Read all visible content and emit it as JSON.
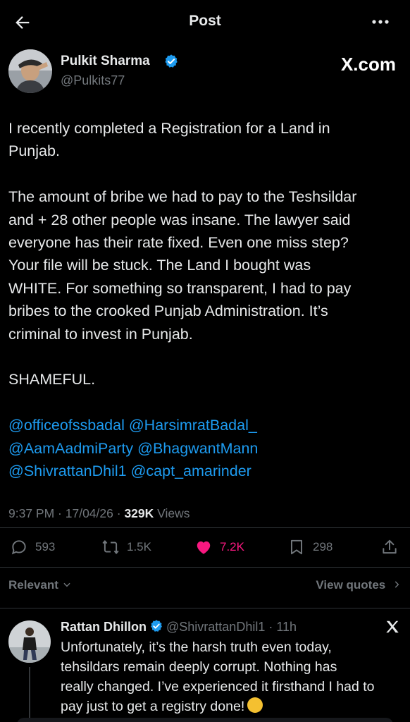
{
  "header": {
    "title": "Post"
  },
  "watermark": "X.com",
  "author": {
    "name": "Pulkit Sharma",
    "handle": "@Pulkits77"
  },
  "post": {
    "lines": [
      "I recently completed a Registration for a Land in",
      "Punjab.",
      "",
      "The amount of bribe we had to pay to the Teshsildar",
      "and + 28 other people was insane. The lawyer said",
      "everyone has their rate fixed. Even one miss step?",
      "Your file will be stuck. The Land I bought was",
      "WHITE. For something so transparent, I had to pay",
      "bribes to the crooked Punjab Administration. It’s",
      "criminal to invest in Punjab.",
      "",
      "SHAMEFUL.",
      ""
    ],
    "mentions": [
      [
        "@officeofssbadal",
        "@HarsimratBadal_"
      ],
      [
        "@AamAadmiParty",
        "@BhagwantMann"
      ],
      [
        "@ShivrattanDhil1",
        "@capt_amarinder"
      ]
    ]
  },
  "meta": {
    "time": "9:37 PM",
    "date": "17/04/26",
    "views_count": "329K",
    "views_label": "Views"
  },
  "actions": {
    "replies": "593",
    "reposts": "1.5K",
    "likes": "7.2K",
    "bookmarks": "298"
  },
  "colors": {
    "accent": "#1d9bf0",
    "like": "#f91880",
    "muted": "#71767b",
    "verified": "#1d9bf0"
  },
  "sort": {
    "label": "Relevant",
    "view_quotes": "View quotes"
  },
  "reply": {
    "name": "Rattan Dhillon",
    "handle": "@ShivrattanDhil1",
    "time": "11h",
    "lines": [
      "Unfortunately, it’s the harsh truth even today,",
      "tehsildars remain deeply corrupt. Nothing has",
      "really changed. I’ve experienced it firsthand I had to",
      "pay just to get a registry done!"
    ]
  },
  "icons": [
    "back-arrow-icon",
    "more-icon",
    "verified-badge-icon",
    "reply-icon",
    "repost-icon",
    "heart-icon",
    "bookmark-icon",
    "share-icon",
    "chevron-down-icon",
    "chevron-right-icon",
    "x-logo-icon",
    "emoji-icon"
  ]
}
